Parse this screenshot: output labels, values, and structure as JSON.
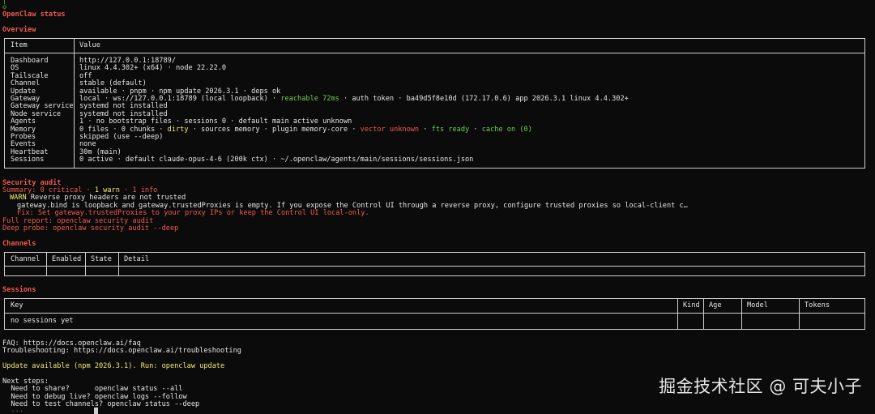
{
  "prompt_glyph": "◇",
  "top_mark": "│",
  "title": "OpenClaw status",
  "overview": {
    "heading": "Overview",
    "col_item": "Item",
    "col_value": "Value",
    "rows": [
      {
        "item": "Dashboard",
        "value": "http://127.0.0.1:18789/"
      },
      {
        "item": "OS",
        "value": "linux 4.4.302+ (x64) · node 22.22.0"
      },
      {
        "item": "Tailscale",
        "value": "off"
      },
      {
        "item": "Channel",
        "value": "stable (default)"
      },
      {
        "item": "Update",
        "value": "available · pnpm · npm update 2026.3.1 · deps ok"
      },
      {
        "item": "Gateway",
        "v1": "local · ws://127.0.0.1:18789 (local loopback) · ",
        "v2": "reachable 72ms",
        "v3": " · auth token · ba49d5f8e10d (172.17.0.6) app 2026.3.1 linux 4.4.302+"
      },
      {
        "item": "Gateway service",
        "value": "systemd not installed"
      },
      {
        "item": "Node service",
        "value": "systemd not installed"
      },
      {
        "item": "Agents",
        "value": "1 · no bootstrap files · sessions 0 · default main active unknown"
      },
      {
        "item": "Memory",
        "m1": "0 files · 0 chunks · ",
        "m2": "dirty",
        "m3": " · sources memory · plugin memory-core · ",
        "m4": "vector unknown",
        "m5": " · ",
        "m6": "fts ready",
        "m7": " · ",
        "m8": "cache on (0)"
      },
      {
        "item": "Probes",
        "value": "skipped (use --deep)"
      },
      {
        "item": "Events",
        "value": "none"
      },
      {
        "item": "Heartbeat",
        "value": "30m (main)"
      },
      {
        "item": "Sessions",
        "value": "0 active · default claude-opus-4-6 (200k ctx) · ~/.openclaw/agents/main/sessions/sessions.json"
      }
    ]
  },
  "security": {
    "heading": "Security audit",
    "summary_a": "Summary: 0 critical · ",
    "summary_b": "1 warn",
    "summary_c": " · 1 info",
    "warn_tag": "WARN",
    "warn_text": " Reverse proxy headers are not trusted",
    "detail": "gateway.bind is loopback and gateway.trustedProxies is empty. If you expose the Control UI through a reverse proxy, configure trusted proxies so local-client c…",
    "fix": "Fix: Set gateway.trustedProxies to your proxy IPs or keep the Control UI local-only.",
    "full_report": "Full report: openclaw security audit",
    "deep_probe": "Deep probe: openclaw security audit --deep"
  },
  "channels": {
    "heading": "Channels",
    "columns": [
      "Channel",
      "Enabled",
      "State",
      "Detail"
    ]
  },
  "sessions": {
    "heading": "Sessions",
    "columns": [
      "Key",
      "Kind",
      "Age",
      "Model",
      "Tokens"
    ],
    "empty": "no sessions yet"
  },
  "footer": {
    "faq": "FAQ: https://docs.openclaw.ai/faq",
    "troubleshooting": "Troubleshooting: https://docs.openclaw.ai/troubleshooting",
    "update": "Update available (npm 2026.3.1). Run: openclaw update",
    "next_steps": "Next steps:",
    "steps": [
      "  Need to share?      openclaw status --all",
      "  Need to debug live? openclaw logs --follow",
      "  Need to test channels? openclaw status --deep"
    ],
    "prompt_partial": "  ..."
  },
  "watermark": "掘金技术社区 @ 可夫小子",
  "colors": {
    "background": "#0b0b0b",
    "heading_red": "#f05a4f",
    "warn_yellow": "#f1ec73",
    "ok_green": "#6fce58",
    "border": "#cfcfcf"
  }
}
